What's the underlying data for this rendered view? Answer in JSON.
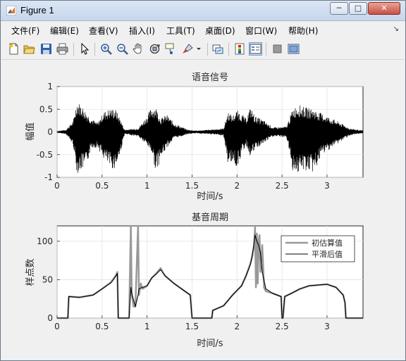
{
  "window": {
    "title": "Figure 1"
  },
  "window_controls": {
    "minimize": "─",
    "maximize": "□",
    "close": "✕"
  },
  "menu": [
    "文件(F)",
    "编辑(E)",
    "查看(V)",
    "插入(I)",
    "工具(T)",
    "桌面(D)",
    "窗口(W)",
    "帮助(H)"
  ],
  "toolbar_icons": [
    "new-figure-icon",
    "open-file-icon",
    "save-icon",
    "print-icon",
    "edit-plot-arrow-icon",
    "zoom-in-icon",
    "zoom-out-icon",
    "pan-hand-icon",
    "rotate-3d-icon",
    "data-cursor-icon",
    "brush-icon",
    "brush-dropdown-icon",
    "link-plot-icon",
    "insert-colorbar-icon",
    "insert-legend-icon",
    "hide-plot-tools-icon",
    "show-plot-tools-icon"
  ],
  "chart_data": [
    {
      "type": "line",
      "title": "语音信号",
      "xlabel": "时间/s",
      "ylabel": "幅值",
      "xlim": [
        0,
        3.4
      ],
      "ylim": [
        -1,
        1
      ],
      "xticks": [
        "0",
        "0.5",
        "1",
        "1.5",
        "2",
        "2.5",
        "3"
      ],
      "yticks": [
        "-1",
        "-0.5",
        "0",
        "0.5",
        "1"
      ],
      "grid": true,
      "series": [
        {
          "color": "#000000",
          "envelope_t": [
            0,
            0.1,
            0.18,
            0.22,
            0.27,
            0.32,
            0.38,
            0.45,
            0.52,
            0.6,
            0.65,
            0.7,
            0.75,
            0.9,
            1.0,
            1.05,
            1.1,
            1.15,
            1.22,
            1.3,
            1.38,
            1.45,
            1.55,
            1.7,
            1.85,
            1.9,
            1.95,
            2.0,
            2.05,
            2.1,
            2.15,
            2.2,
            2.3,
            2.4,
            2.55,
            2.62,
            2.68,
            2.75,
            2.85,
            2.95,
            3.05,
            3.15,
            3.25,
            3.4
          ],
          "envelope_pos": [
            0.02,
            0.05,
            0.25,
            0.68,
            0.6,
            0.45,
            0.3,
            0.2,
            0.45,
            0.52,
            0.5,
            0.3,
            0.05,
            0.08,
            0.35,
            0.55,
            0.55,
            0.3,
            0.38,
            0.2,
            0.12,
            0.05,
            0.03,
            0.05,
            0.08,
            0.45,
            0.35,
            0.48,
            0.4,
            0.3,
            0.55,
            0.35,
            0.25,
            0.1,
            0.12,
            0.52,
            0.6,
            0.55,
            0.5,
            0.4,
            0.3,
            0.2,
            0.08,
            0.03
          ],
          "envelope_neg": [
            0.02,
            0.05,
            0.3,
            0.92,
            0.85,
            0.8,
            0.35,
            0.35,
            0.6,
            0.82,
            0.8,
            0.5,
            0.05,
            0.1,
            0.3,
            0.45,
            0.9,
            0.6,
            0.35,
            0.15,
            0.1,
            0.05,
            0.03,
            0.05,
            0.08,
            0.72,
            0.65,
            0.8,
            0.5,
            0.3,
            0.55,
            0.4,
            0.25,
            0.1,
            0.12,
            0.85,
            0.92,
            0.85,
            0.9,
            0.5,
            0.35,
            0.22,
            0.08,
            0.03
          ]
        }
      ]
    },
    {
      "type": "line",
      "title": "基音周期",
      "xlabel": "时间/s",
      "ylabel": "样点数",
      "xlim": [
        0,
        3.4
      ],
      "ylim": [
        0,
        120
      ],
      "xticks": [
        "0",
        "0.5",
        "1",
        "1.5",
        "2",
        "2.5",
        "3"
      ],
      "yticks": [
        "0",
        "50",
        "100"
      ],
      "grid": true,
      "legend": "top-right",
      "series": [
        {
          "name": "初估算值",
          "color": "#999999",
          "x": [
            0,
            0.12,
            0.13,
            0.25,
            0.4,
            0.5,
            0.6,
            0.65,
            0.67,
            0.68,
            0.8,
            0.82,
            0.83,
            0.85,
            0.87,
            0.9,
            0.91,
            0.93,
            0.95,
            1.0,
            1.05,
            1.1,
            1.15,
            1.2,
            1.3,
            1.48,
            1.5,
            1.51,
            1.72,
            1.73,
            1.85,
            1.95,
            2.05,
            2.1,
            2.15,
            2.17,
            2.19,
            2.2,
            2.21,
            2.22,
            2.23,
            2.24,
            2.25,
            2.26,
            2.28,
            2.3,
            2.32,
            2.4,
            2.49,
            2.5,
            2.51,
            2.53,
            2.6,
            2.7,
            2.8,
            2.9,
            3.0,
            3.1,
            3.18,
            3.2,
            3.21,
            3.4
          ],
          "y": [
            0,
            0,
            28,
            27,
            30,
            38,
            47,
            55,
            60,
            0,
            0,
            120,
            30,
            15,
            15,
            120,
            30,
            45,
            38,
            42,
            52,
            58,
            65,
            55,
            45,
            30,
            0,
            0,
            0,
            10,
            16,
            30,
            42,
            55,
            72,
            80,
            95,
            118,
            40,
            110,
            45,
            100,
            108,
            60,
            95,
            40,
            35,
            32,
            28,
            0,
            0,
            28,
            32,
            38,
            42,
            43,
            44,
            40,
            30,
            20,
            0,
            0
          ]
        },
        {
          "name": "平滑后值",
          "color": "#000000",
          "x": [
            0,
            0.12,
            0.13,
            0.25,
            0.4,
            0.5,
            0.6,
            0.65,
            0.67,
            0.68,
            0.8,
            0.82,
            0.83,
            0.87,
            0.9,
            0.91,
            0.95,
            1.0,
            1.05,
            1.1,
            1.15,
            1.2,
            1.3,
            1.48,
            1.5,
            1.51,
            1.72,
            1.73,
            1.85,
            1.95,
            2.05,
            2.1,
            2.15,
            2.18,
            2.2,
            2.22,
            2.24,
            2.26,
            2.28,
            2.32,
            2.4,
            2.49,
            2.5,
            2.51,
            2.53,
            2.6,
            2.7,
            2.8,
            2.9,
            3.0,
            3.1,
            3.18,
            3.2,
            3.21,
            3.4
          ],
          "y": [
            0,
            0,
            28,
            27,
            30,
            38,
            46,
            54,
            58,
            0,
            0,
            40,
            32,
            15,
            30,
            38,
            40,
            42,
            52,
            57,
            63,
            55,
            45,
            30,
            0,
            0,
            0,
            10,
            16,
            30,
            42,
            55,
            70,
            90,
            108,
            100,
            95,
            85,
            60,
            38,
            32,
            28,
            0,
            0,
            28,
            32,
            38,
            42,
            43,
            44,
            40,
            30,
            20,
            0,
            0
          ]
        }
      ]
    }
  ]
}
